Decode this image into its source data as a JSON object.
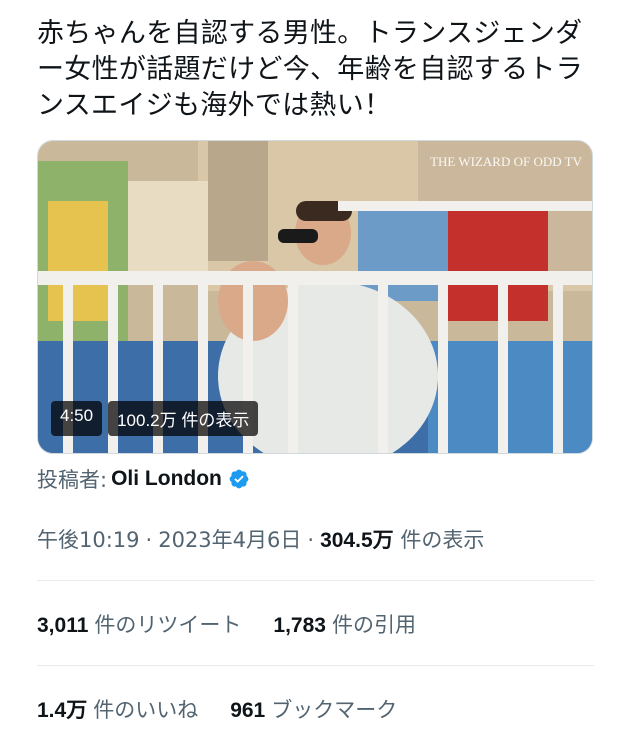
{
  "tweet": {
    "text": "赤ちゃんを自認する男性。トランスジェンダー女性が話題だけど今、年齢を自認するトランスエイジも海外では熱い！"
  },
  "media": {
    "duration": "4:50",
    "views": "100.2万 件の表示",
    "watermark": "THE WIZARD OF ODD TV"
  },
  "author": {
    "label": "投稿者:",
    "name": "Oli London",
    "verified_icon": "verified-badge-icon",
    "verified_color": "#1d9bf0"
  },
  "meta": {
    "time": "午後10:19",
    "sep1": "·",
    "date": "2023年4月6日",
    "sep2": "·",
    "views_count": "304.5万",
    "views_label": "件の表示"
  },
  "stats": {
    "retweets_count": "3,011",
    "retweets_label": "件のリツイート",
    "quotes_count": "1,783",
    "quotes_label": "件の引用",
    "likes_count": "1.4万",
    "likes_label": "件のいいね",
    "bookmarks_count": "961",
    "bookmarks_label": "ブックマーク"
  }
}
